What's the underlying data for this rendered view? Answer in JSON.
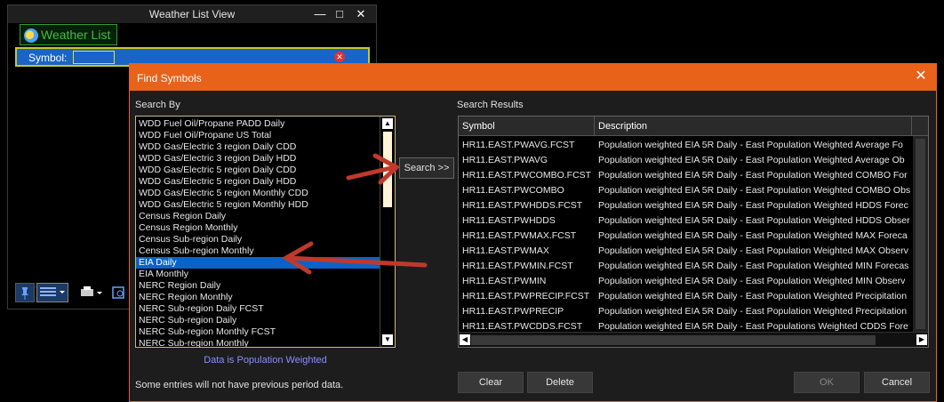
{
  "weather_window": {
    "title": "Weather List View",
    "tab_label": "Weather List",
    "symbol_label": "Symbol:"
  },
  "dialog": {
    "title": "Find Symbols",
    "search_by_label": "Search By",
    "search_button": "Search >>",
    "search_results_label": "Search Results",
    "population_note": "Data is Population Weighted",
    "previous_period_note": "Some entries will not have previous period data.",
    "buttons": {
      "clear": "Clear",
      "delete": "Delete",
      "ok": "OK",
      "cancel": "Cancel"
    }
  },
  "search_by_items": [
    "WDD Fuel Oil/Propane PADD Daily",
    "WDD Fuel Oil/Propane US Total",
    "WDD Gas/Electric 3 region Daily CDD",
    "WDD Gas/Electric 3 region Daily HDD",
    "WDD Gas/Electric 5 region Daily CDD",
    "WDD Gas/Electric 5 region Daily HDD",
    "WDD Gas/Electric 5 region Monthly CDD",
    "WDD Gas/Electric 5 region Monthly HDD",
    "Census Region Daily",
    "Census Region Monthly",
    "Census Sub-region Daily",
    "Census Sub-region Monthly",
    "EIA Daily",
    "EIA Monthly",
    "NERC Region Daily",
    "NERC Region Monthly",
    "NERC Sub-region Daily FCST",
    "NERC Sub-region Daily",
    "NERC Sub-region Monthly FCST",
    "NERC Sub-region Monthly"
  ],
  "selected_search_by": "EIA Daily",
  "results": {
    "columns": [
      "Symbol",
      "Description"
    ],
    "rows": [
      [
        "HR11.EAST.PWAVG.FCST",
        "Population weighted EIA 5R Daily - East Population Weighted Average Fo"
      ],
      [
        "HR11.EAST.PWAVG",
        "Population weighted EIA 5R Daily - East Population Weighted Average Ob"
      ],
      [
        "HR11.EAST.PWCOMBO.FCST",
        "Population weighted EIA 5R Daily - East Population Weighted COMBO For"
      ],
      [
        "HR11.EAST.PWCOMBO",
        "Population weighted EIA 5R Daily - East Population Weighted COMBO Obs"
      ],
      [
        "HR11.EAST.PWHDDS.FCST",
        "Population weighted EIA 5R Daily - East Population Weighted HDDS Forec"
      ],
      [
        "HR11.EAST.PWHDDS",
        "Population weighted EIA 5R Daily - East Population Weighted HDDS Obser"
      ],
      [
        "HR11.EAST.PWMAX.FCST",
        "Population weighted EIA 5R Daily - East Population Weighted MAX Foreca"
      ],
      [
        "HR11.EAST.PWMAX",
        "Population weighted EIA 5R Daily - East Population Weighted MAX Observ"
      ],
      [
        "HR11.EAST.PWMIN.FCST",
        "Population weighted EIA 5R Daily - East Population Weighted MIN Forecas"
      ],
      [
        "HR11.EAST.PWMIN",
        "Population weighted EIA 5R Daily - East Population Weighted MIN Observ"
      ],
      [
        "HR11.EAST.PWPRECIP.FCST",
        "Population weighted EIA 5R Daily - East Population Weighted Precipitation"
      ],
      [
        "HR11.EAST.PWPRECIP",
        "Population weighted EIA 5R Daily - East Population Weighted Precipitation"
      ],
      [
        "HR11.EAST.PWCDDS.FCST",
        "Population weighted EIA 5R Daily - East Populations Weighted CDDS Fore"
      ]
    ]
  },
  "colors": {
    "dialog_accent": "#e8621a",
    "selection": "#0a63c9",
    "annotation_arrow": "#c0392b",
    "note_text": "#8c8cff"
  }
}
